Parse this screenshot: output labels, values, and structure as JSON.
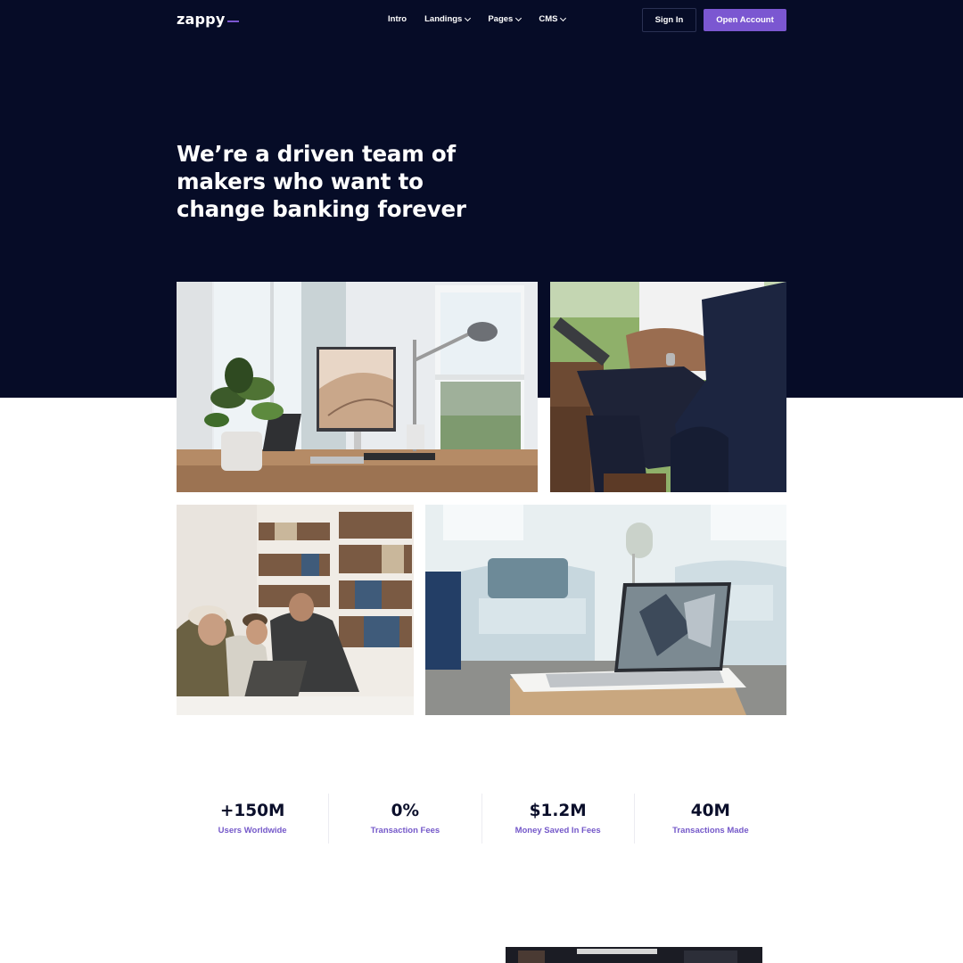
{
  "brand": {
    "name": "zappy",
    "accent_color": "#7b57d1",
    "hero_bg_color": "#060c27"
  },
  "nav": {
    "items": [
      {
        "label": "Intro",
        "has_dropdown": false
      },
      {
        "label": "Landings",
        "has_dropdown": true
      },
      {
        "label": "Pages",
        "has_dropdown": true
      },
      {
        "label": "CMS",
        "has_dropdown": true
      }
    ],
    "sign_in_label": "Sign In",
    "open_account_label": "Open Account"
  },
  "hero": {
    "headline": "We’re a driven team of makers who want to change banking forever"
  },
  "stats": [
    {
      "value": "+150M",
      "label": "Users Worldwide"
    },
    {
      "value": "0%",
      "label": "Transaction Fees"
    },
    {
      "value": "$1.2M",
      "label": "Money Saved In Fees"
    },
    {
      "value": "40M",
      "label": "Transactions Made"
    }
  ]
}
